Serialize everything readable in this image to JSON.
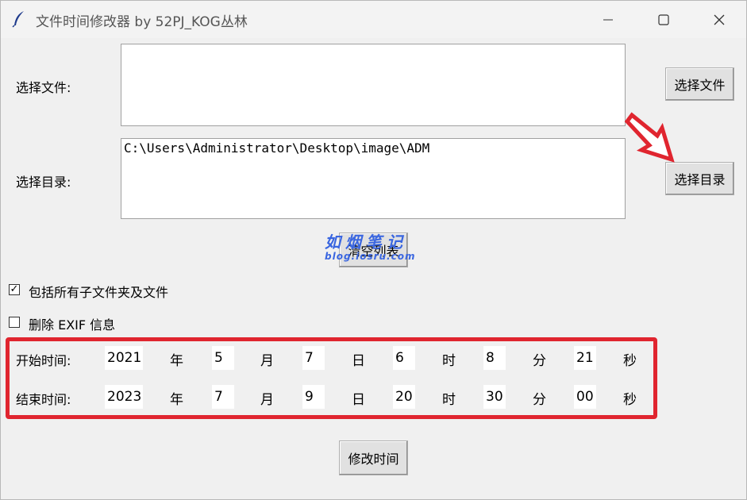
{
  "window": {
    "title": "文件时间修改器 by 52PJ_KOG丛林"
  },
  "file_section": {
    "label": "选择文件:",
    "value": "",
    "button": "选择文件"
  },
  "dir_section": {
    "label": "选择目录:",
    "value": "C:\\Users\\Administrator\\Desktop\\image\\ADM",
    "button": "选择目录"
  },
  "clear_button": "清空列表",
  "options": {
    "include_subfolders": {
      "label": "包括所有子文件夹及文件",
      "checked": true
    },
    "delete_exif": {
      "label": "删除 EXIF 信息",
      "checked": false
    }
  },
  "start_time": {
    "label": "开始时间:",
    "year": "2021",
    "month": "5",
    "day": "7",
    "hour": "6",
    "minute": "8",
    "second": "21"
  },
  "end_time": {
    "label": "结束时间:",
    "year": "2023",
    "month": "7",
    "day": "9",
    "hour": "20",
    "minute": "30",
    "second": "00"
  },
  "units": {
    "year": "年",
    "month": "月",
    "day": "日",
    "hour": "时",
    "minute": "分",
    "second": "秒"
  },
  "modify_button": "修改时间",
  "watermark": {
    "main": "如烟笔记",
    "sub": "blog.iosru.com"
  },
  "colors": {
    "highlight": "#e0252f",
    "watermark": "#3a66e0"
  }
}
